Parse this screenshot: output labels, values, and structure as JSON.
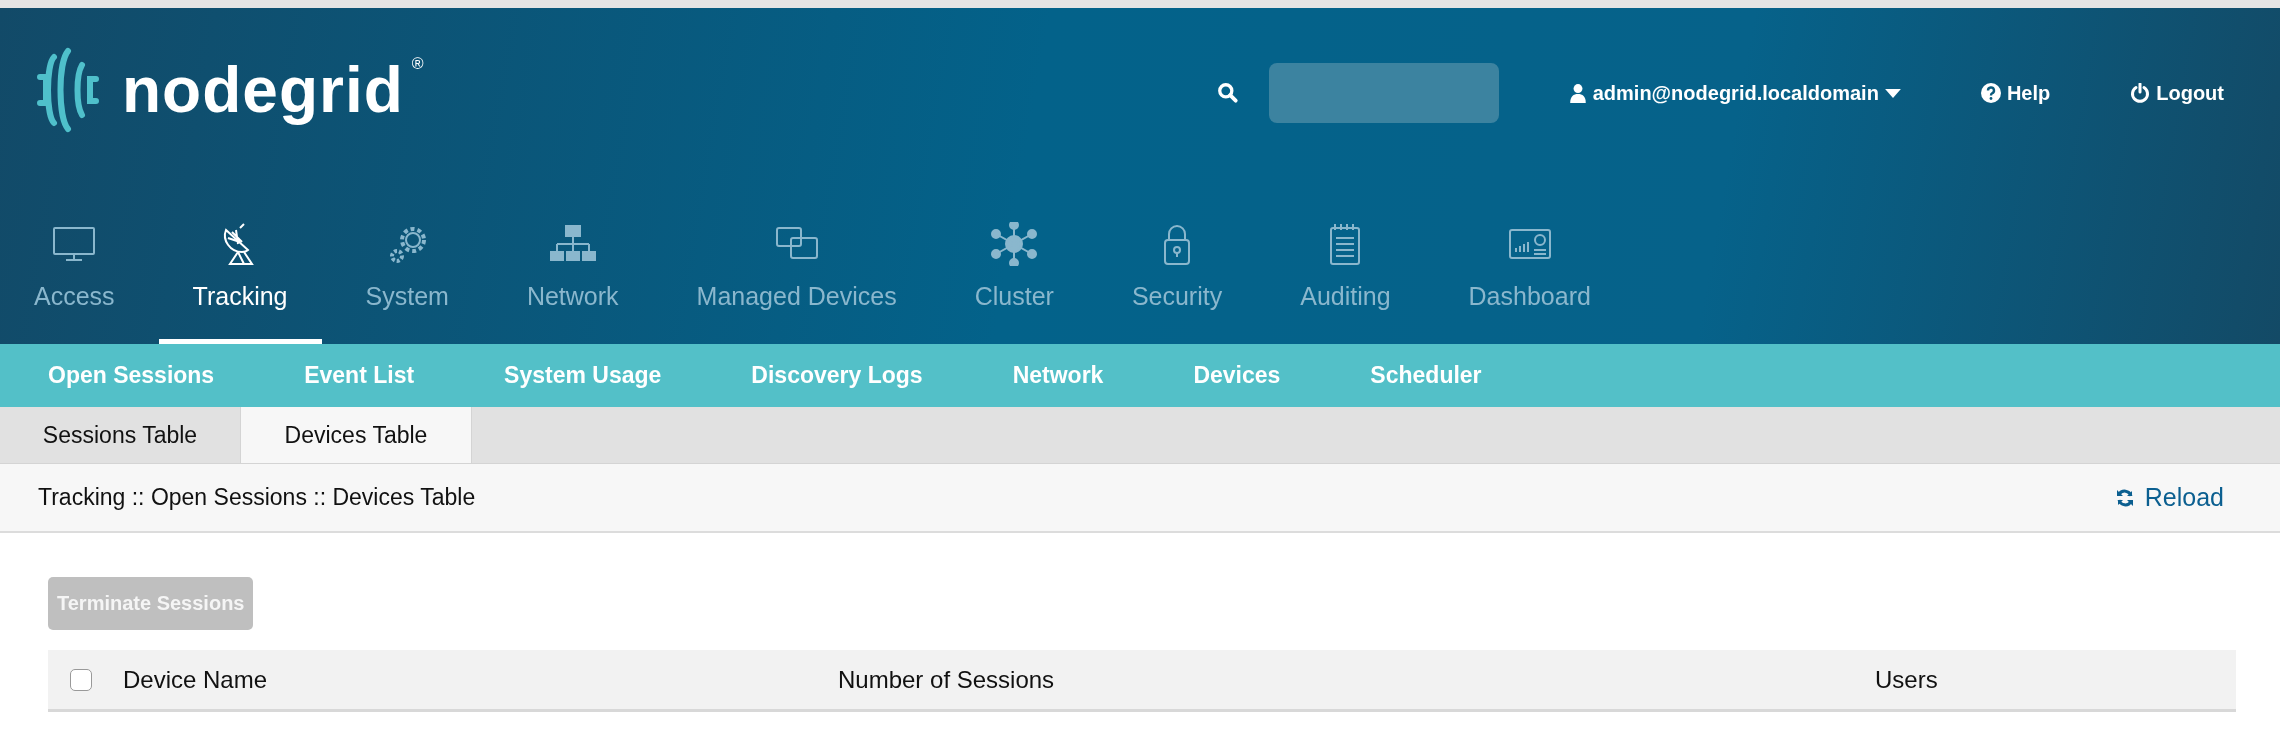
{
  "header": {
    "logo": {
      "text": "nodegrid",
      "mark": "®"
    },
    "user": {
      "label": "admin@nodegrid.localdomain"
    },
    "help": {
      "label": "Help"
    },
    "logout": {
      "label": "Logout"
    }
  },
  "main_nav": [
    {
      "label": "Access",
      "selected": false
    },
    {
      "label": "Tracking",
      "selected": true
    },
    {
      "label": "System",
      "selected": false
    },
    {
      "label": "Network",
      "selected": false
    },
    {
      "label": "Managed Devices",
      "selected": false
    },
    {
      "label": "Cluster",
      "selected": false
    },
    {
      "label": "Security",
      "selected": false
    },
    {
      "label": "Auditing",
      "selected": false
    },
    {
      "label": "Dashboard",
      "selected": false
    }
  ],
  "sub_nav": [
    "Open Sessions",
    "Event List",
    "System Usage",
    "Discovery Logs",
    "Network",
    "Devices",
    "Scheduler"
  ],
  "tabs": [
    {
      "label": "Sessions Table",
      "selected": false
    },
    {
      "label": "Devices Table",
      "selected": true
    }
  ],
  "breadcrumb": "Tracking :: Open Sessions :: Devices Table",
  "reload": {
    "label": "Reload"
  },
  "terminate_button": {
    "label": "Terminate Sessions",
    "disabled": true
  },
  "table": {
    "select_all": {
      "checked": false
    },
    "columns": [
      "Device Name",
      "Number of Sessions",
      "Users"
    ]
  }
}
